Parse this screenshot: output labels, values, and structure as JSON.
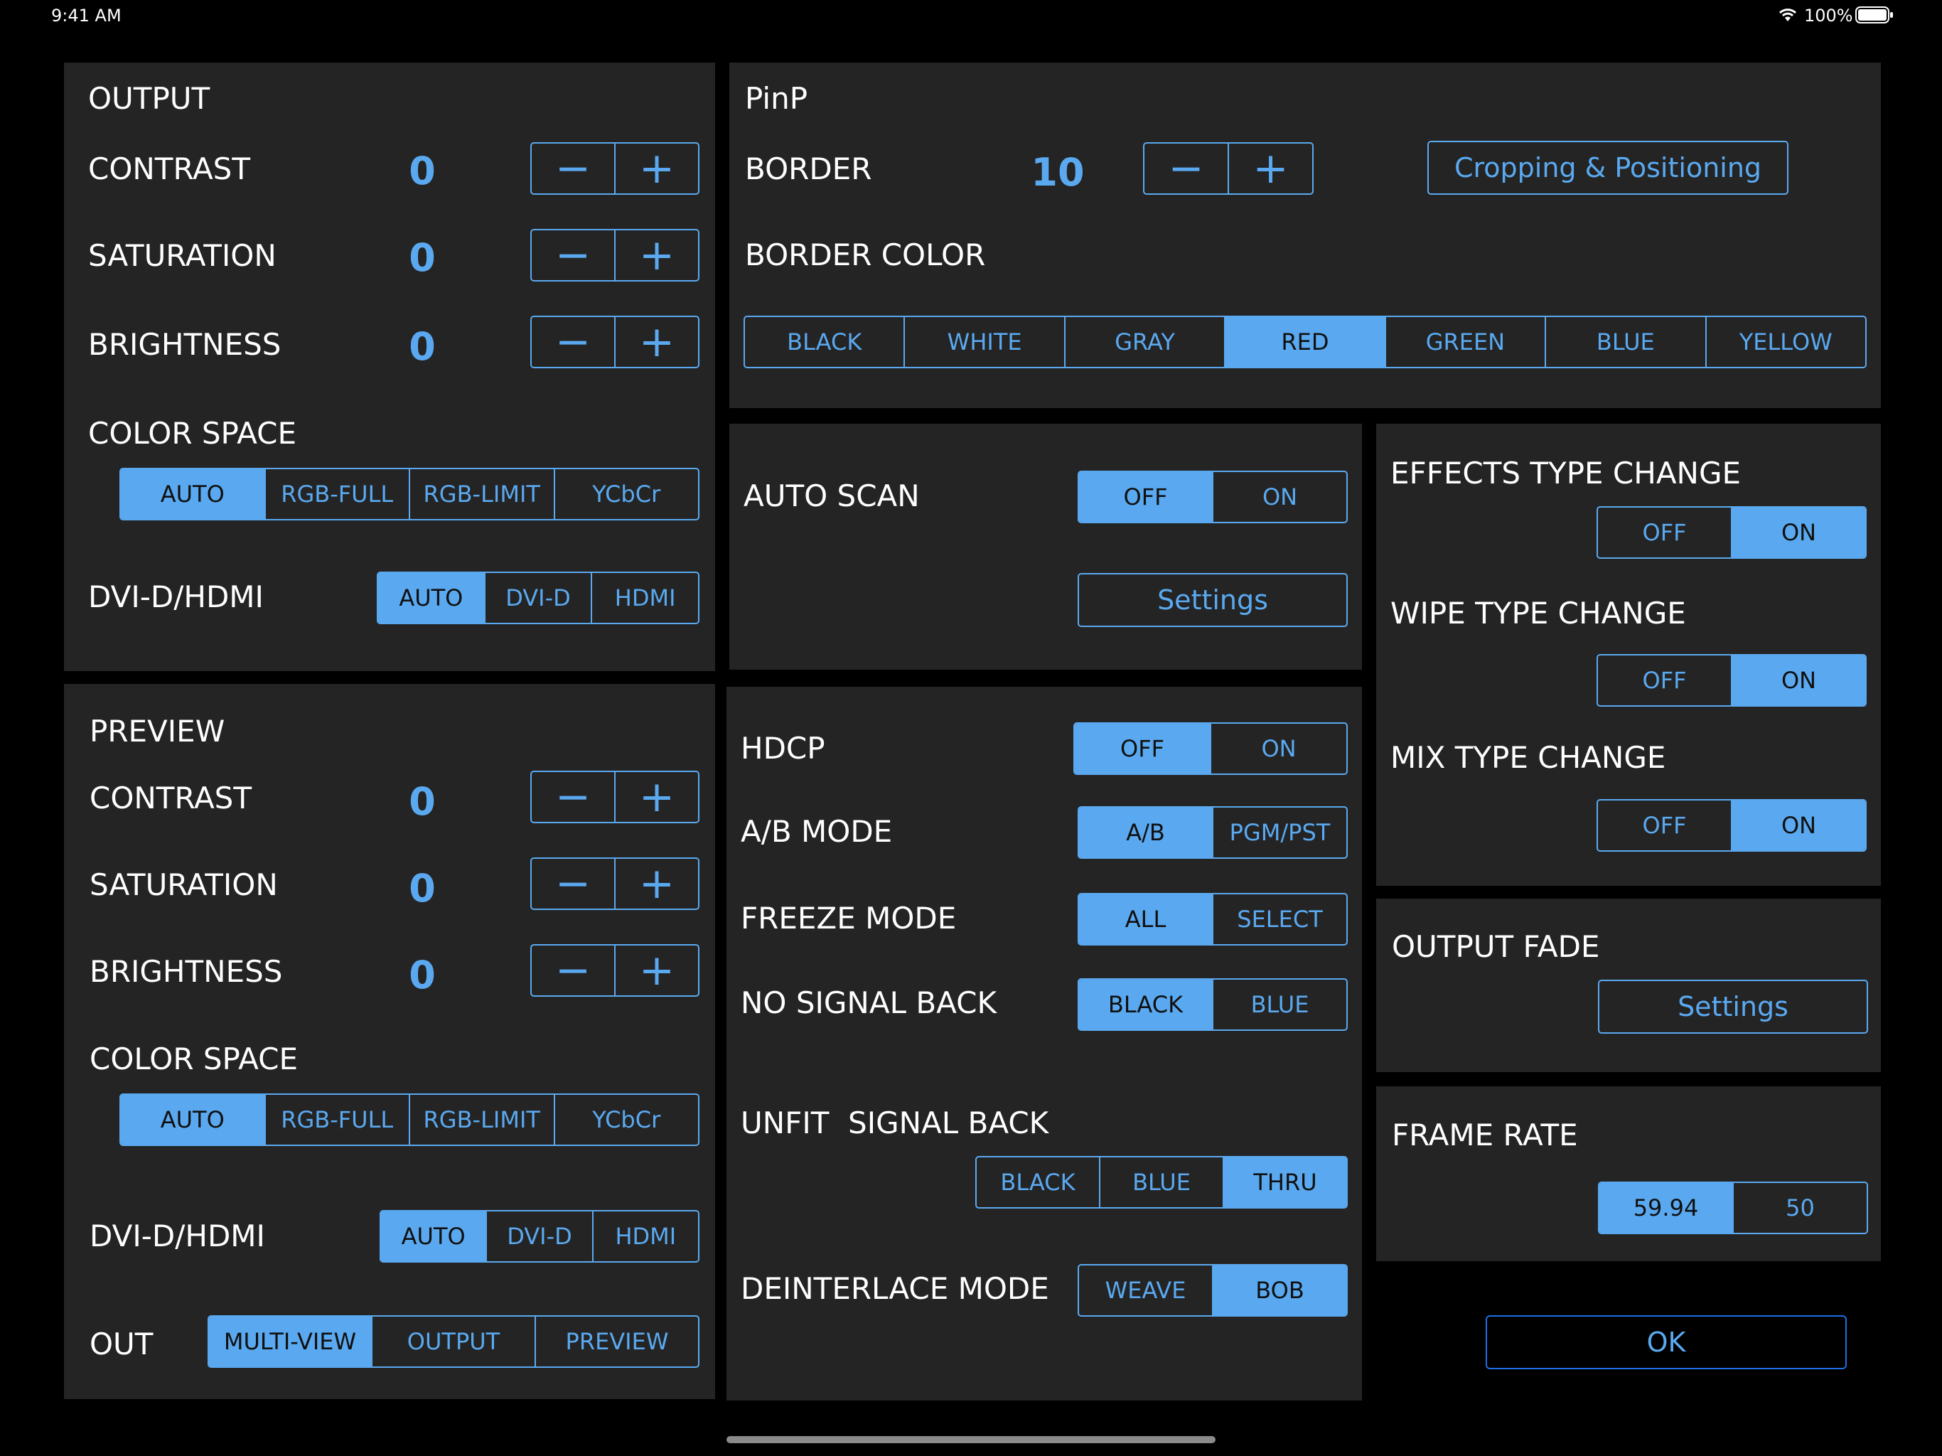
{
  "status": {
    "time": "9:41 AM",
    "battery": "100%"
  },
  "labels": {
    "output": "OUTPUT",
    "preview": "PREVIEW",
    "pinp": "PinP",
    "contrast": "CONTRAST",
    "saturation": "SATURATION",
    "brightness": "BRIGHTNESS",
    "color_space": "COLOR SPACE",
    "dvi_hdmi": "DVI-D/HDMI",
    "out": "OUT",
    "border": "BORDER",
    "border_color": "BORDER COLOR",
    "auto_scan": "AUTO SCAN",
    "hdcp": "HDCP",
    "ab_mode": "A/B MODE",
    "freeze_mode": "FREEZE MODE",
    "no_signal_back": "NO SIGNAL BACK",
    "unfit_signal_back": "UNFIT  SIGNAL BACK",
    "deinterlace_mode": "DEINTERLACE MODE",
    "effects_type_change": "EFFECTS TYPE CHANGE",
    "wipe_type_change": "WIPE TYPE CHANGE",
    "mix_type_change": "MIX TYPE CHANGE",
    "output_fade": "OUTPUT FADE",
    "frame_rate": "FRAME RATE"
  },
  "symbols": {
    "minus": "−",
    "plus": "+"
  },
  "values": {
    "output_contrast": "0",
    "output_saturation": "0",
    "output_brightness": "0",
    "preview_contrast": "0",
    "preview_saturation": "0",
    "preview_brightness": "0",
    "border": "10"
  },
  "options": {
    "color_space": [
      "AUTO",
      "RGB-FULL",
      "RGB-LIMIT",
      "YCbCr"
    ],
    "dvi_hdmi": [
      "AUTO",
      "DVI-D",
      "HDMI"
    ],
    "out": [
      "MULTI-VIEW",
      "OUTPUT",
      "PREVIEW"
    ],
    "border_color": [
      "BLACK",
      "WHITE",
      "GRAY",
      "RED",
      "GREEN",
      "BLUE",
      "YELLOW"
    ],
    "off_on": [
      "OFF",
      "ON"
    ],
    "ab_mode": [
      "A/B",
      "PGM/PST"
    ],
    "freeze_mode": [
      "ALL",
      "SELECT"
    ],
    "no_signal_back": [
      "BLACK",
      "BLUE"
    ],
    "unfit_signal_back": [
      "BLACK",
      "BLUE",
      "THRU"
    ],
    "deinterlace_mode": [
      "WEAVE",
      "BOB"
    ],
    "frame_rate": [
      "59.94",
      "50"
    ]
  },
  "selected": {
    "output_color_space": "AUTO",
    "output_dvi_hdmi": "AUTO",
    "preview_color_space": "AUTO",
    "preview_dvi_hdmi": "AUTO",
    "preview_out": "MULTI-VIEW",
    "border_color": "RED",
    "auto_scan": "OFF",
    "hdcp": "OFF",
    "ab_mode": "A/B",
    "freeze_mode": "ALL",
    "no_signal_back": "BLACK",
    "unfit_signal_back": "THRU",
    "deinterlace_mode": "BOB",
    "effects_type_change": "ON",
    "wipe_type_change": "ON",
    "mix_type_change": "ON",
    "frame_rate": "59.94"
  },
  "buttons": {
    "cropping_positioning": "Cropping & Positioning",
    "auto_scan_settings": "Settings",
    "output_fade_settings": "Settings",
    "ok": "OK"
  },
  "colors": {
    "accent": "#5aa9f0",
    "panel": "#242424",
    "background": "#000000",
    "ok_border": "#1e6ee8"
  }
}
